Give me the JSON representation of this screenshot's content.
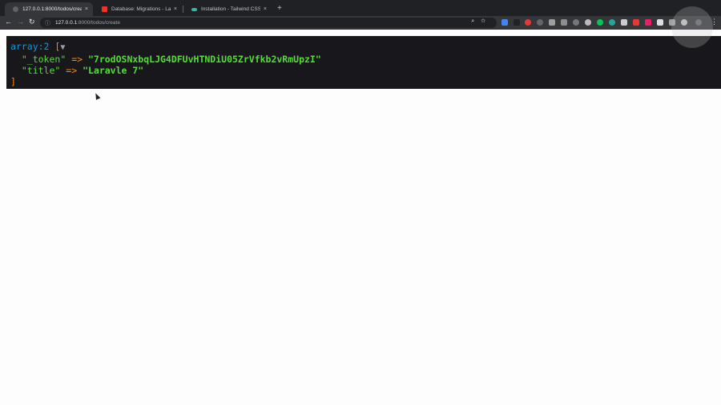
{
  "browser": {
    "tabs": [
      {
        "title": "127.0.0.1:8000/todos/create",
        "active": true,
        "favicon_color": "#5f6368"
      },
      {
        "title": "Database: Migrations - Laravel -",
        "active": false,
        "favicon_color": "#ff2d20"
      },
      {
        "title": "Installation - Tailwind CSS",
        "active": false,
        "favicon_color": "#38b2ac"
      }
    ],
    "close_glyph": "×",
    "new_tab_glyph": "+",
    "nav": {
      "back": "←",
      "forward": "→",
      "reload": "↻",
      "info": "ⓘ"
    },
    "url": {
      "host": "127.0.0.1",
      "path": ":8000/todos/create"
    },
    "omnibox_icons": [
      "zoom-icon",
      "star-icon"
    ],
    "extension_colors": [
      "#4285f4",
      "#222222",
      "#e53935",
      "#666666",
      "#9e9e9e",
      "#8e8e8e",
      "#777777",
      "#bbbbbb",
      "#00c853",
      "#26a69a",
      "#cccccc",
      "#e53935",
      "#e91e63",
      "#dddddd",
      "#9e9e9e",
      "#bdbdbd"
    ],
    "menu_glyph": "⋮"
  },
  "dump": {
    "header_kw": "array:2",
    "open_bracket": "[",
    "toggle": "▼",
    "entries": [
      {
        "key": "\"_token\"",
        "arrow": "=>",
        "value": "\"7rodOSNxbqLJG4DFUvHTNDiU05ZrVfkb2vRmUpzI\""
      },
      {
        "key": "\"title\"",
        "arrow": "=>",
        "value": "\"Laravle 7\""
      }
    ],
    "close_bracket": "]"
  }
}
